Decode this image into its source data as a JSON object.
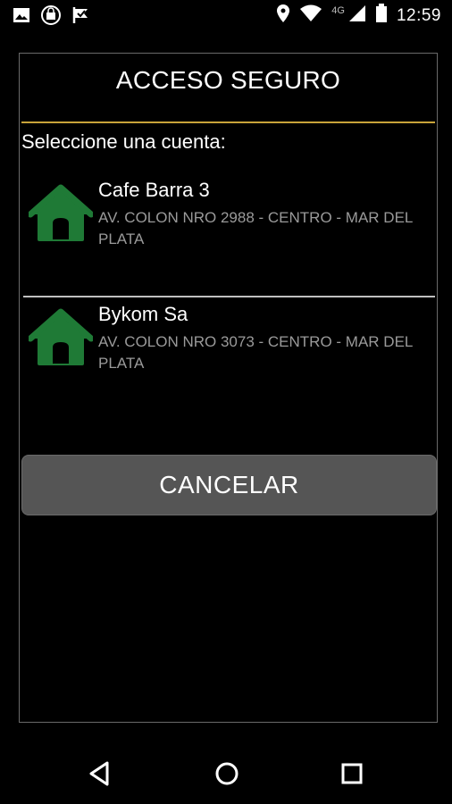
{
  "status_bar": {
    "time": "12:59",
    "network": "4G",
    "left_icons": [
      "image-icon",
      "shopping-icon",
      "check-flag-icon"
    ],
    "right_icons": [
      "location-icon",
      "wifi-icon",
      "signal-icon",
      "battery-icon"
    ]
  },
  "dialog": {
    "title": "ACCESO SEGURO",
    "prompt": "Seleccione una cuenta:",
    "accent_color": "#c8a33a",
    "accounts": [
      {
        "name": "Cafe Barra 3",
        "address": "AV. COLON NRO 2988 - CENTRO - MAR DEL PLATA",
        "icon": "house-icon"
      },
      {
        "name": "Bykom Sa",
        "address": "AV. COLON NRO 3073 - CENTRO - MAR DEL PLATA",
        "icon": "house-icon"
      }
    ],
    "cancel_label": "CANCELAR"
  },
  "nav_bar": {
    "buttons": [
      "back-icon",
      "home-icon",
      "recents-icon"
    ]
  },
  "colors": {
    "house_green": "#1f7a36",
    "button_gray": "#555555"
  }
}
